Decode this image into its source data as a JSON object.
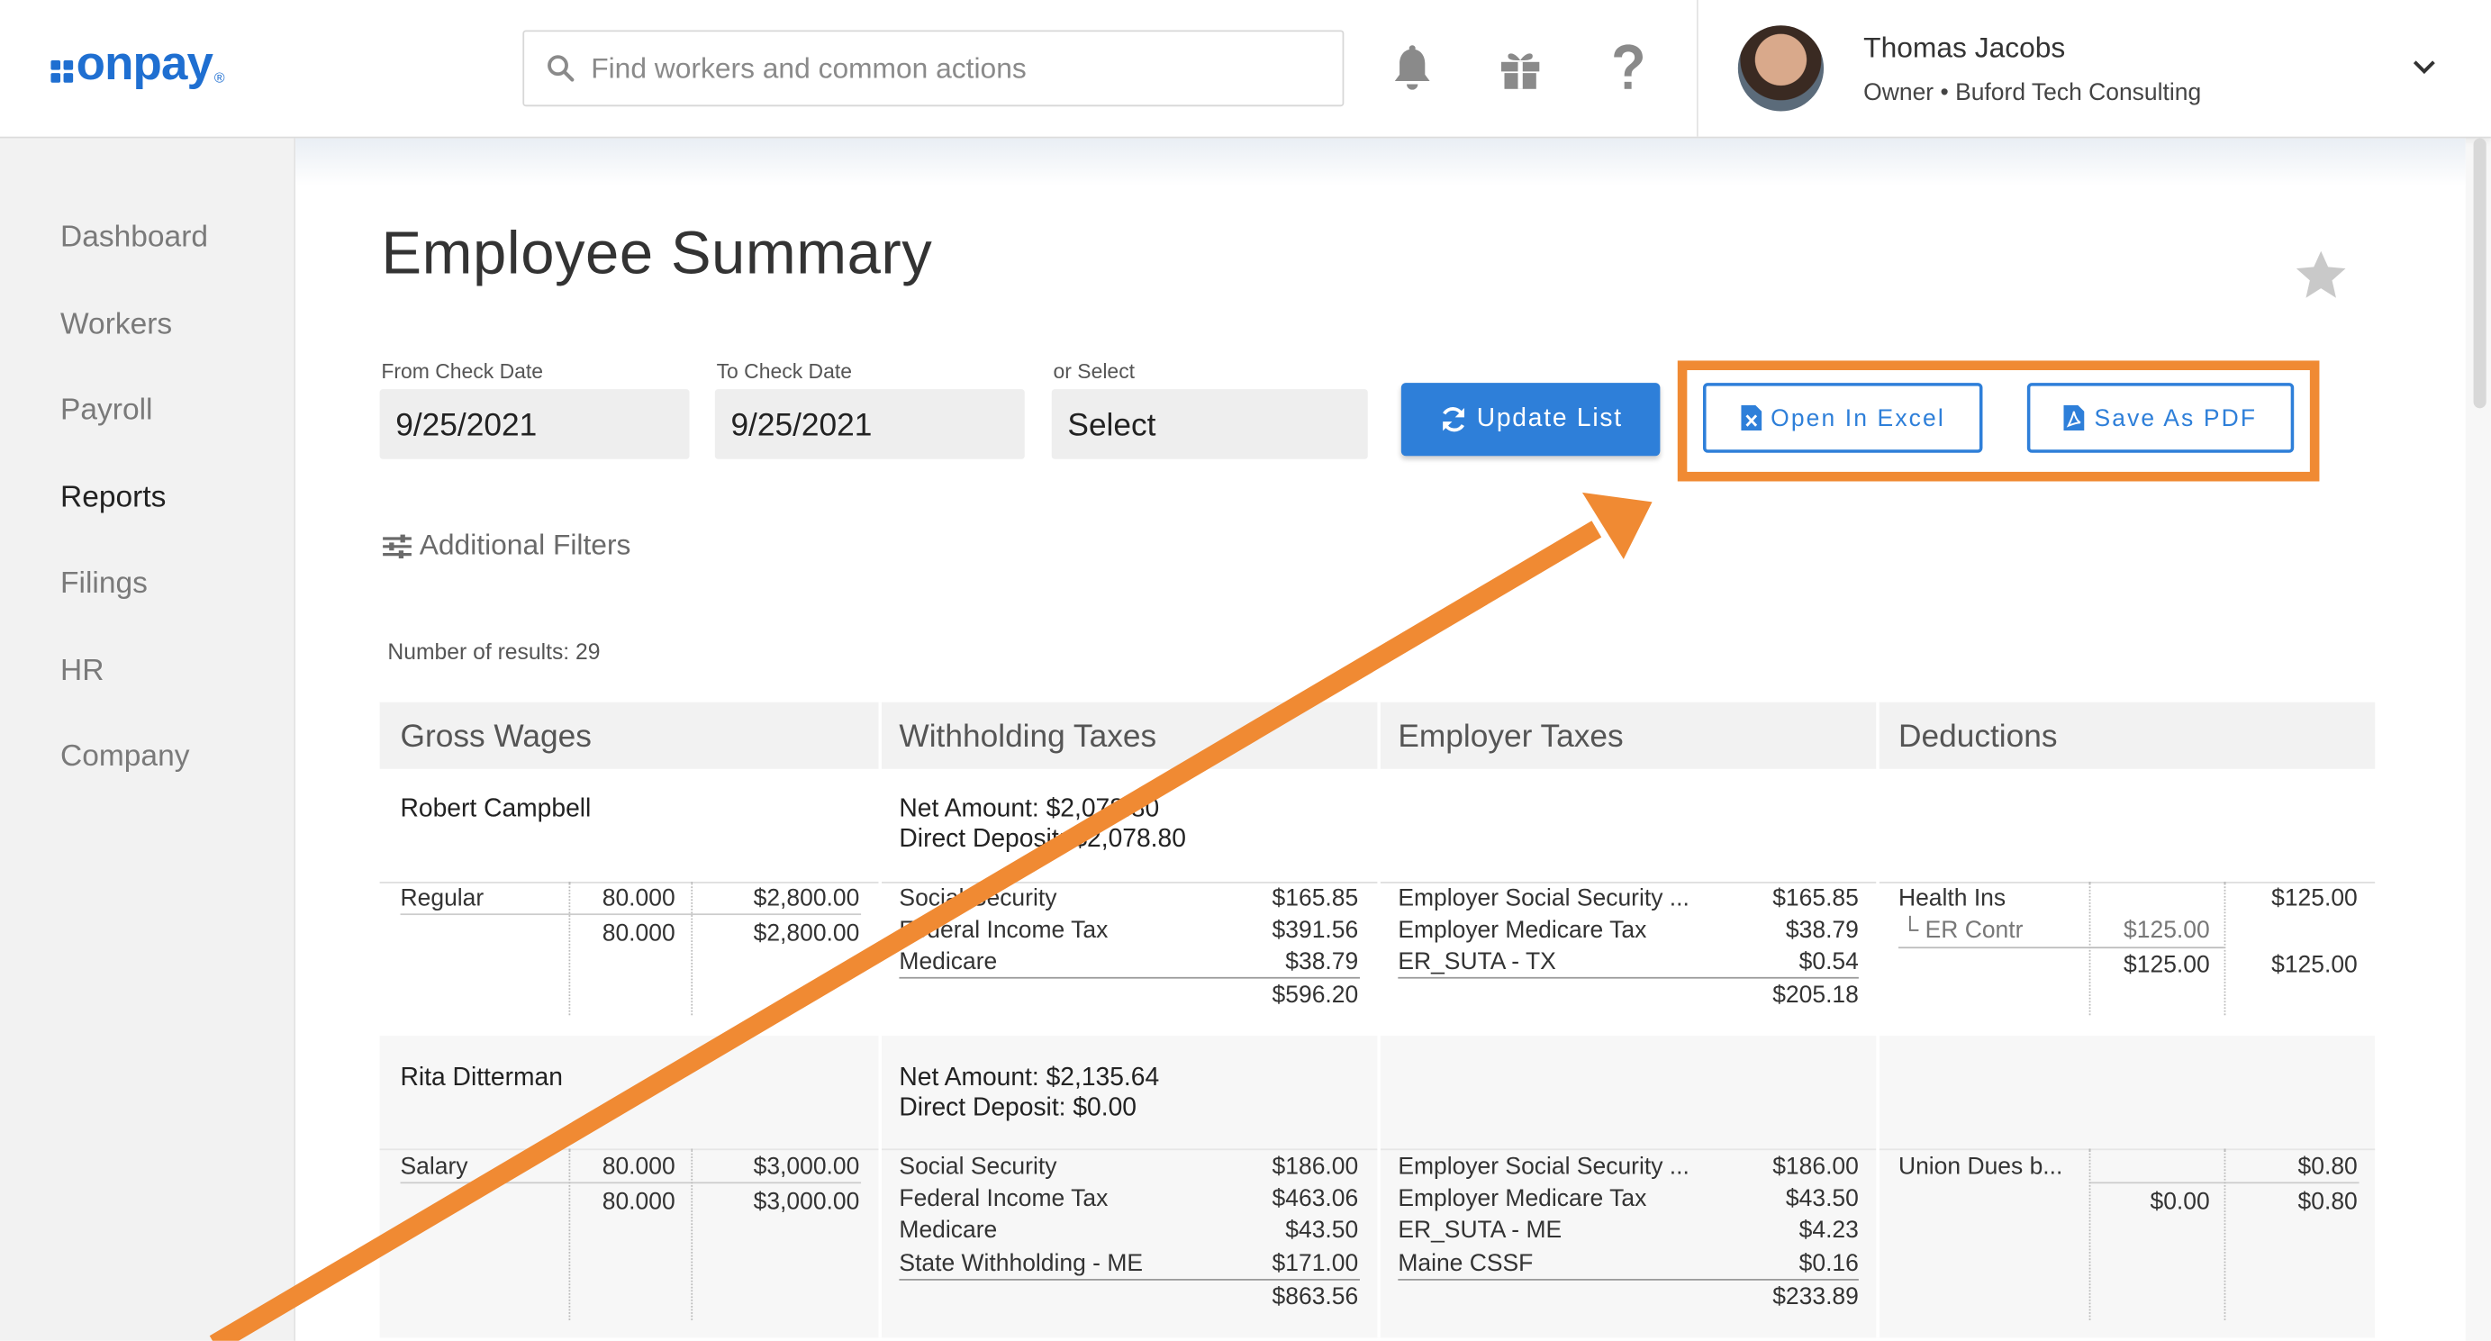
{
  "header": {
    "logo_text": "onpay",
    "logo_reg": "®",
    "search_placeholder": "Find workers and common actions",
    "user_name": "Thomas Jacobs",
    "user_role": "Owner • Buford Tech Consulting"
  },
  "sidebar": {
    "items": [
      {
        "label": "Dashboard"
      },
      {
        "label": "Workers"
      },
      {
        "label": "Payroll"
      },
      {
        "label": "Reports"
      },
      {
        "label": "Filings"
      },
      {
        "label": "HR"
      },
      {
        "label": "Company"
      }
    ],
    "active": "Reports"
  },
  "page": {
    "title": "Employee Summary",
    "filters": {
      "from_label": "From Check Date",
      "from_value": "9/25/2021",
      "to_label": "To Check Date",
      "to_value": "9/25/2021",
      "select_label": "or Select",
      "select_value": "Select"
    },
    "buttons": {
      "update": "Update List",
      "excel": "Open In Excel",
      "pdf": "Save As PDF"
    },
    "additional_filters": "Additional Filters",
    "results": "Number of results: 29"
  },
  "table": {
    "headers": [
      "Gross Wages",
      "Withholding Taxes",
      "Employer Taxes",
      "Deductions"
    ],
    "employees": [
      {
        "name": "Robert Campbell",
        "net_amount": "Net Amount: $2,078.80",
        "direct_deposit": "Direct Deposit: $2,078.80",
        "wages": {
          "type": "Regular",
          "hours": "80.000",
          "amount": "$2,800.00",
          "total_hours": "80.000",
          "total_amount": "$2,800.00"
        },
        "withholding": [
          {
            "name": "Social Security",
            "amount": "$165.85"
          },
          {
            "name": "Federal Income Tax",
            "amount": "$391.56"
          },
          {
            "name": "Medicare",
            "amount": "$38.79"
          }
        ],
        "withholding_total": "$596.20",
        "employer": [
          {
            "name": "Employer Social Security ...",
            "amount": "$165.85"
          },
          {
            "name": "Employer Medicare Tax",
            "amount": "$38.79"
          },
          {
            "name": "ER_SUTA - TX",
            "amount": "$0.54"
          }
        ],
        "employer_total": "$205.18",
        "deductions": {
          "name": "Health Ins",
          "amount": "$125.00",
          "sub_name": "ER Contr",
          "sub_amount": "$125.00",
          "total_contr": "$125.00",
          "total": "$125.00"
        }
      },
      {
        "name": "Rita Ditterman",
        "net_amount": "Net Amount: $2,135.64",
        "direct_deposit": "Direct Deposit: $0.00",
        "wages": {
          "type": "Salary",
          "hours": "80.000",
          "amount": "$3,000.00",
          "total_hours": "80.000",
          "total_amount": "$3,000.00"
        },
        "withholding": [
          {
            "name": "Social Security",
            "amount": "$186.00"
          },
          {
            "name": "Federal Income Tax",
            "amount": "$463.06"
          },
          {
            "name": "Medicare",
            "amount": "$43.50"
          },
          {
            "name": "State Withholding - ME",
            "amount": "$171.00"
          }
        ],
        "withholding_total": "$863.56",
        "employer": [
          {
            "name": "Employer Social Security ...",
            "amount": "$186.00"
          },
          {
            "name": "Employer Medicare Tax",
            "amount": "$43.50"
          },
          {
            "name": "ER_SUTA - ME",
            "amount": "$4.23"
          },
          {
            "name": "Maine CSSF",
            "amount": "$0.16"
          }
        ],
        "employer_total": "$233.89",
        "deductions": {
          "name": "Union Dues b...",
          "amount": "$0.80",
          "total_contr": "$0.00",
          "total": "$0.80"
        }
      }
    ]
  },
  "colors": {
    "brand": "#1f6fd1",
    "primary_button": "#2e7fd9",
    "annotation": "#f08a33"
  },
  "icons": [
    "search-icon",
    "bell-icon",
    "gift-icon",
    "help-icon",
    "chevron-down-icon",
    "star-icon",
    "refresh-icon",
    "excel-file-icon",
    "pdf-file-icon",
    "filter-sliders-icon"
  ]
}
